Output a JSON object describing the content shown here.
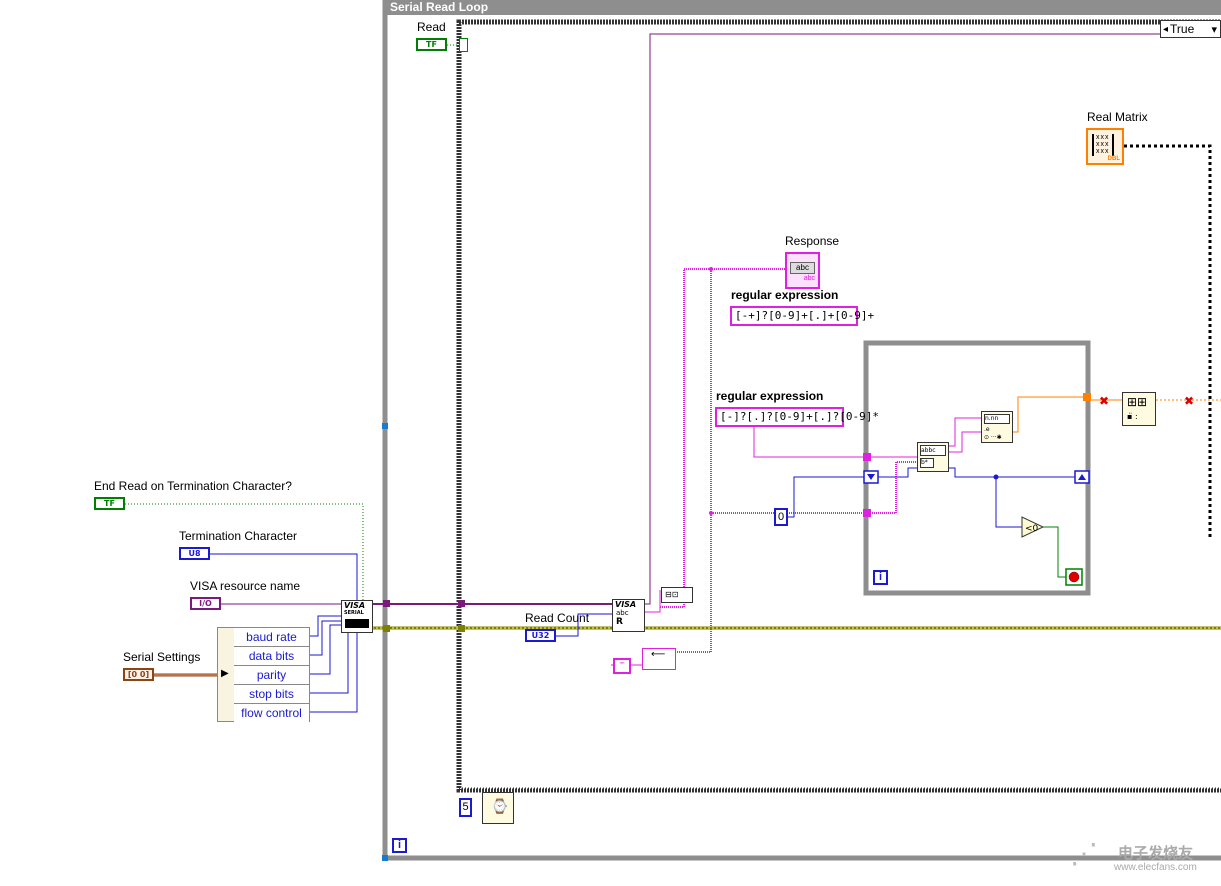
{
  "while_loop": {
    "title": "Serial Read Loop",
    "iteration_terminal": "i"
  },
  "case_structure": {
    "selector_value": "True",
    "selector_arrow_left": "◂",
    "selector_arrow_right": "▾"
  },
  "controls": {
    "read": {
      "label": "Read",
      "type": "TF"
    },
    "end_read": {
      "label": "End Read on Termination Character?",
      "type": "TF"
    },
    "termination_char": {
      "label": "Termination Character",
      "type": "U8"
    },
    "visa_resource": {
      "label": "VISA resource name",
      "type": "I/O"
    },
    "serial_settings": {
      "label": "Serial Settings",
      "type": "[0 0]"
    },
    "read_count": {
      "label": "Read Count",
      "type": "U32"
    }
  },
  "indicators": {
    "response": {
      "label": "Response",
      "text": "abc",
      "type": "abc"
    },
    "real_matrix": {
      "label": "Real Matrix",
      "type": "DBL"
    }
  },
  "bundle_items": [
    "baud rate",
    "data bits",
    "parity",
    "stop bits",
    "flow control"
  ],
  "regex_constants": [
    {
      "label": "regular expression",
      "value": "[-+]?[0-9]+[.]+[0-9]+"
    },
    {
      "label": "regular expression",
      "value": "[-]?[.]?[0-9]+[.]?[0-9]*"
    }
  ],
  "numeric_constants": {
    "zero": "0",
    "wait_ms": "5",
    "compare": "<0"
  },
  "for_loop": {
    "iteration_terminal": "i"
  },
  "visa_node": {
    "title": "VISA",
    "sub": "SERIAL"
  },
  "visa_read": {
    "title": "VISA",
    "sub": "abc",
    "mode": "R"
  },
  "watermark": {
    "cn": "电子发烧友",
    "url": "www.elecfans.com"
  },
  "colors": {
    "boolean": "#008000",
    "numeric_u": "#1a1ad0",
    "string": "#e020e0",
    "visa": "#7a1a7a",
    "cluster": "#8b4513",
    "error": "#808000",
    "dbl": "#ff8000"
  }
}
